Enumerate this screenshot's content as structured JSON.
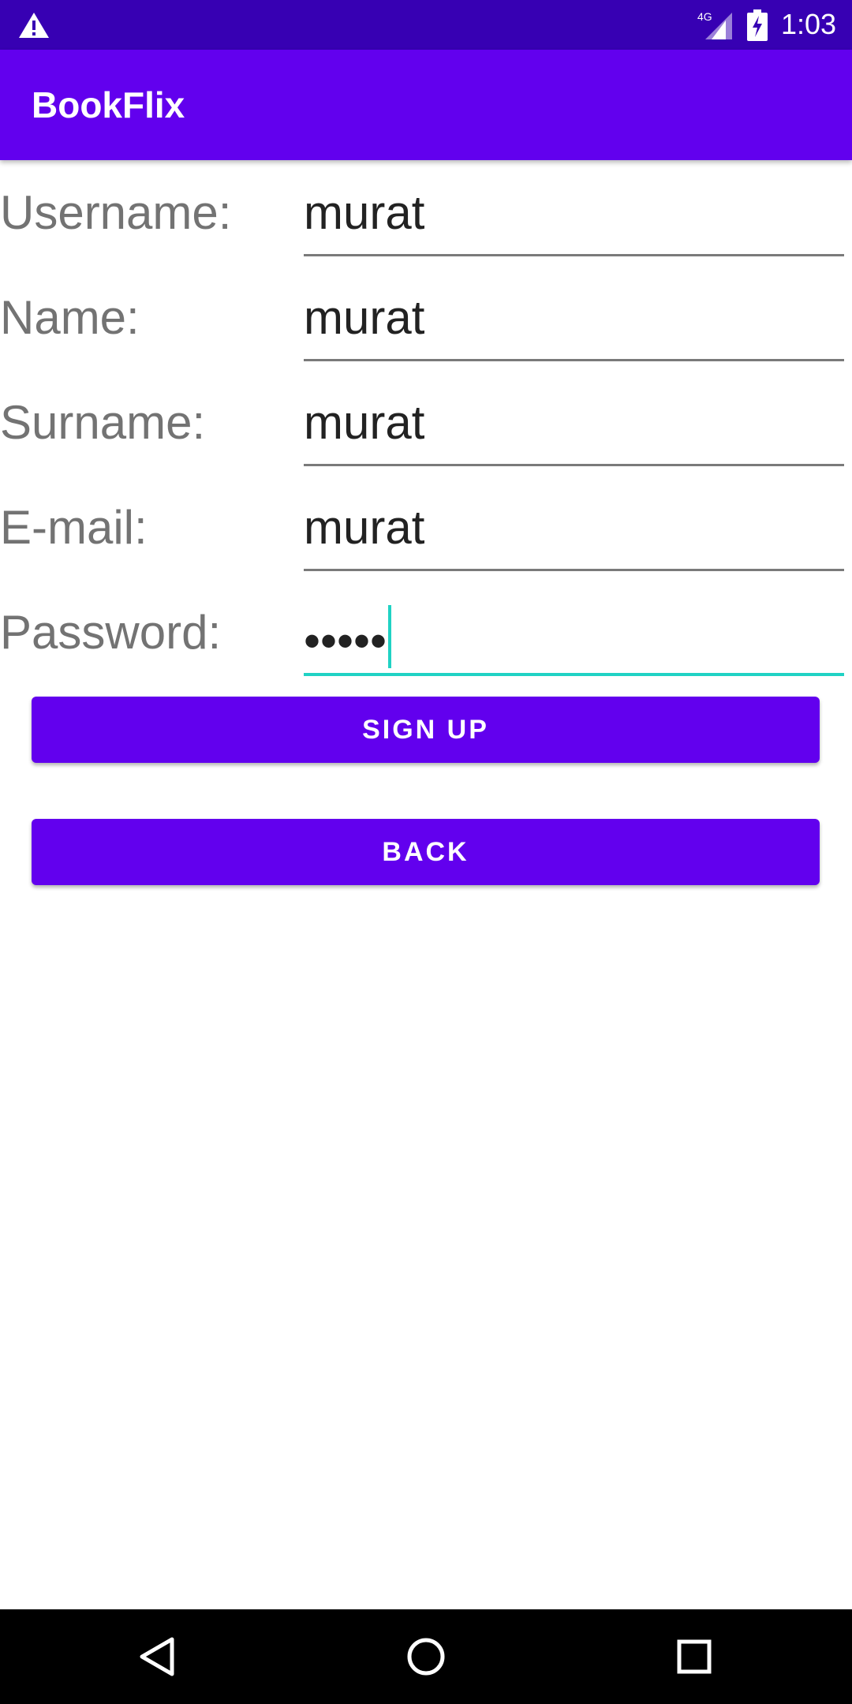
{
  "status_bar": {
    "time": "1:03",
    "network": "4G",
    "icons": [
      "warning-icon",
      "cell-signal-icon",
      "battery-charging-icon"
    ]
  },
  "app_bar": {
    "title": "BookFlix"
  },
  "form": {
    "fields": [
      {
        "label": "Username:",
        "value": "murat"
      },
      {
        "label": "Name:",
        "value": "murat"
      },
      {
        "label": "Surname:",
        "value": "murat"
      },
      {
        "label": "E-mail:",
        "value": "murat"
      },
      {
        "label": "Password:",
        "value": "•••••"
      }
    ],
    "focused_field": "Password:"
  },
  "buttons": {
    "sign_up": "SIGN UP",
    "back": "BACK"
  },
  "nav_bar": {
    "icons": [
      "back-icon",
      "home-icon",
      "recents-icon"
    ]
  },
  "colors": {
    "status_bar": "#3700B3",
    "primary": "#6200EE",
    "accent": "#20D2C4",
    "label_text": "#737373"
  }
}
